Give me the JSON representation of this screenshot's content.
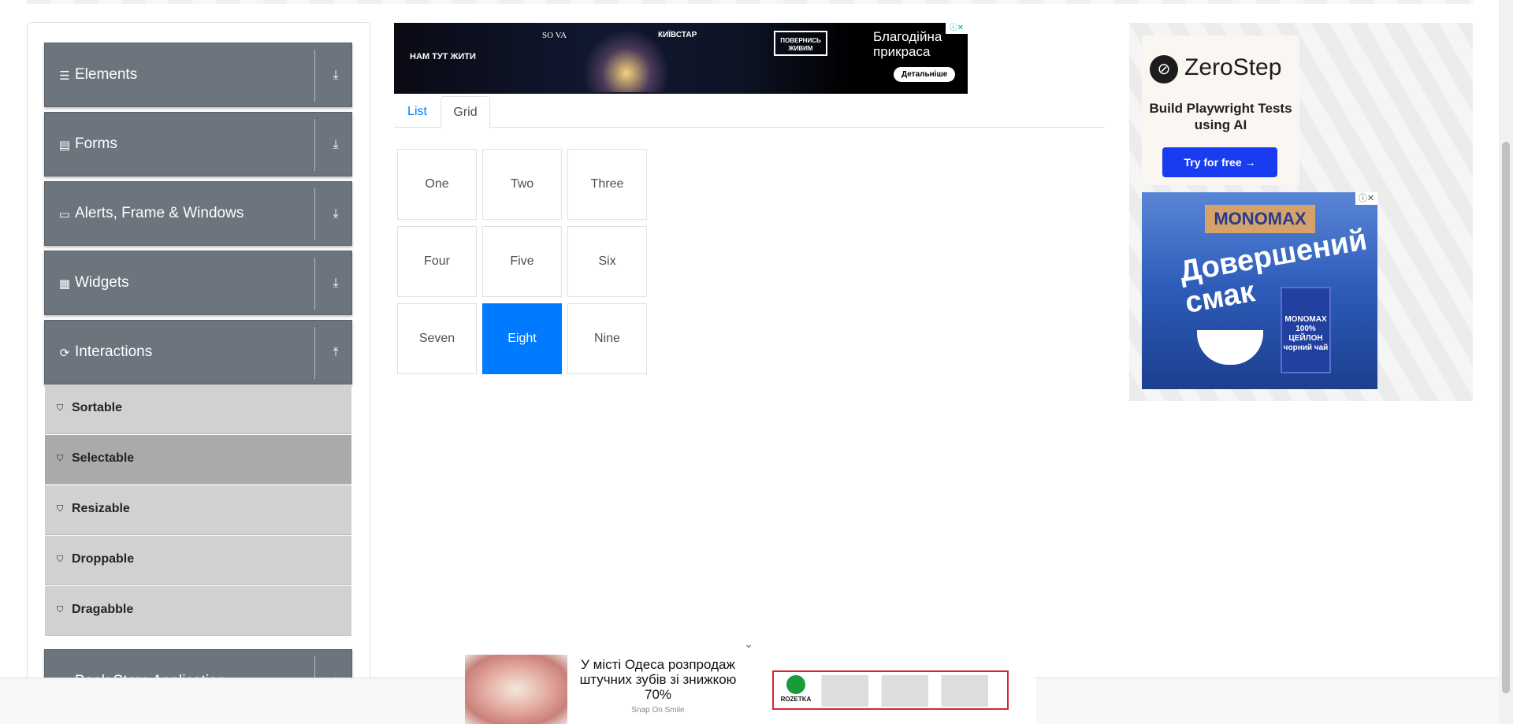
{
  "sidebar": {
    "groups": [
      {
        "label": "Elements",
        "icon": "hamburger-icon"
      },
      {
        "label": "Forms",
        "icon": "document-icon"
      },
      {
        "label": "Alerts, Frame & Windows",
        "icon": "window-icon"
      },
      {
        "label": "Widgets",
        "icon": "widgets-icon"
      },
      {
        "label": "Interactions",
        "icon": "refresh-icon"
      },
      {
        "label": "Book Store Application",
        "icon": "book-icon"
      }
    ],
    "interactions_items": [
      {
        "label": "Sortable",
        "active": false
      },
      {
        "label": "Selectable",
        "active": true
      },
      {
        "label": "Resizable",
        "active": false
      },
      {
        "label": "Droppable",
        "active": false
      },
      {
        "label": "Dragabble",
        "active": false
      }
    ]
  },
  "banner_ad": {
    "logo_a": "НАМ ТУТ ЖИТИ",
    "logo_b": "SO VA",
    "logo_c": "КИЇВСТАР",
    "logo_d": "ПОВЕРНИСЬ ЖИВИМ",
    "text": "Благодійна прикраса",
    "button": "Детальніше"
  },
  "tabs": [
    {
      "label": "List",
      "active": false
    },
    {
      "label": "Grid",
      "active": true
    }
  ],
  "grid": {
    "cells": [
      "One",
      "Two",
      "Three",
      "Four",
      "Five",
      "Six",
      "Seven",
      "Eight",
      "Nine"
    ],
    "selected": "Eight",
    "selected_color": "#007bff"
  },
  "zerostep_ad": {
    "brand": "ZeroStep",
    "tagline": "Build Playwright Tests using AI",
    "button": "Try for free →"
  },
  "monomax_ad": {
    "brand": "MONOMAX",
    "slogan": "Довершений смак",
    "package": "MONOMAX 100% ЦЕЙЛОН чорний чай"
  },
  "bottom_ad": {
    "text": "У місті Одеса розпродаж штучних зубів зі знижкою 70%",
    "source": "Snap On Smile",
    "store": "ROZETKA"
  },
  "colors": {
    "sidebar_group": "#6c757d",
    "sidebar_item": "#d1d1d1",
    "sidebar_item_active": "#aaaaaa",
    "accent": "#007bff"
  }
}
